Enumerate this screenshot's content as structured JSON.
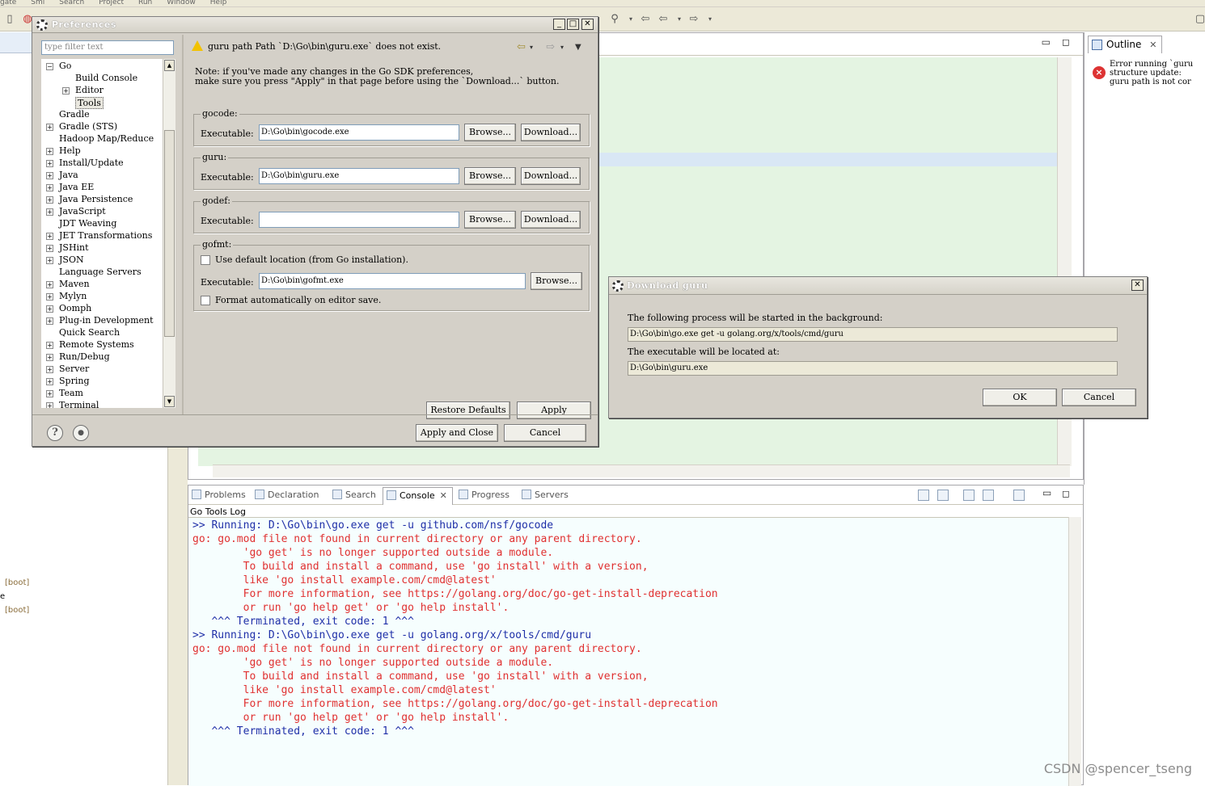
{
  "menubar": [
    "gate",
    "Sml",
    "Search",
    "Project",
    "Run",
    "Window",
    "Help"
  ],
  "left_pane": {
    "boot_labels": [
      "[boot]",
      "[boot]"
    ],
    "stray_char": "e"
  },
  "outline": {
    "tab_label": "Outline",
    "error_lines": "Error running `guru\nstructure update:\nguru path is not cor"
  },
  "console": {
    "tabs": [
      "Problems",
      "Declaration",
      "Search",
      "Console",
      "Progress",
      "Servers"
    ],
    "active_tab": "Console",
    "title": "Go Tools Log",
    "lines": [
      {
        "text": ">> Running: D:\\Go\\bin\\go.exe get -u github.com/nsf/gocode",
        "color": "blue"
      },
      {
        "text": "go: go.mod file not found in current directory or any parent directory.",
        "color": "red"
      },
      {
        "text": "        'go get' is no longer supported outside a module.",
        "color": "red"
      },
      {
        "text": "        To build and install a command, use 'go install' with a version,",
        "color": "red"
      },
      {
        "text": "        like 'go install example.com/cmd@latest'",
        "color": "red"
      },
      {
        "text": "        For more information, see https://golang.org/doc/go-get-install-deprecation",
        "color": "red"
      },
      {
        "text": "        or run 'go help get' or 'go help install'.",
        "color": "red"
      },
      {
        "text": "   ^^^ Terminated, exit code: 1 ^^^",
        "color": "blue"
      },
      {
        "text": ">> Running: D:\\Go\\bin\\go.exe get -u golang.org/x/tools/cmd/guru",
        "color": "blue"
      },
      {
        "text": "go: go.mod file not found in current directory or any parent directory.",
        "color": "red"
      },
      {
        "text": "        'go get' is no longer supported outside a module.",
        "color": "red"
      },
      {
        "text": "        To build and install a command, use 'go install' with a version,",
        "color": "red"
      },
      {
        "text": "        like 'go install example.com/cmd@latest'",
        "color": "red"
      },
      {
        "text": "        For more information, see https://golang.org/doc/go-get-install-deprecation",
        "color": "red"
      },
      {
        "text": "        or run 'go help get' or 'go help install'.",
        "color": "red"
      },
      {
        "text": "   ^^^ Terminated, exit code: 1 ^^^",
        "color": "blue"
      }
    ]
  },
  "prefs": {
    "title": "Preferences",
    "filter_placeholder": "type filter text",
    "tree": [
      {
        "label": "Go",
        "level": 0,
        "exp": "-"
      },
      {
        "label": "Build Console",
        "level": 1,
        "exp": ""
      },
      {
        "label": "Editor",
        "level": 1,
        "exp": "+"
      },
      {
        "label": "Tools",
        "level": 1,
        "exp": "",
        "selected": true
      },
      {
        "label": "Gradle",
        "level": 0,
        "exp": ""
      },
      {
        "label": "Gradle (STS)",
        "level": 0,
        "exp": "+"
      },
      {
        "label": "Hadoop Map/Reduce",
        "level": 0,
        "exp": ""
      },
      {
        "label": "Help",
        "level": 0,
        "exp": "+"
      },
      {
        "label": "Install/Update",
        "level": 0,
        "exp": "+"
      },
      {
        "label": "Java",
        "level": 0,
        "exp": "+"
      },
      {
        "label": "Java EE",
        "level": 0,
        "exp": "+"
      },
      {
        "label": "Java Persistence",
        "level": 0,
        "exp": "+"
      },
      {
        "label": "JavaScript",
        "level": 0,
        "exp": "+"
      },
      {
        "label": "JDT Weaving",
        "level": 0,
        "exp": ""
      },
      {
        "label": "JET Transformations",
        "level": 0,
        "exp": "+"
      },
      {
        "label": "JSHint",
        "level": 0,
        "exp": "+"
      },
      {
        "label": "JSON",
        "level": 0,
        "exp": "+"
      },
      {
        "label": "Language Servers",
        "level": 0,
        "exp": ""
      },
      {
        "label": "Maven",
        "level": 0,
        "exp": "+"
      },
      {
        "label": "Mylyn",
        "level": 0,
        "exp": "+"
      },
      {
        "label": "Oomph",
        "level": 0,
        "exp": "+"
      },
      {
        "label": "Plug-in Development",
        "level": 0,
        "exp": "+"
      },
      {
        "label": "Quick Search",
        "level": 0,
        "exp": ""
      },
      {
        "label": "Remote Systems",
        "level": 0,
        "exp": "+"
      },
      {
        "label": "Run/Debug",
        "level": 0,
        "exp": "+"
      },
      {
        "label": "Server",
        "level": 0,
        "exp": "+"
      },
      {
        "label": "Spring",
        "level": 0,
        "exp": "+"
      },
      {
        "label": "Team",
        "level": 0,
        "exp": "+"
      },
      {
        "label": "Terminal",
        "level": 0,
        "exp": "+"
      }
    ],
    "warning": "guru path Path `D:\\Go\\bin\\guru.exe` does not exist.",
    "note": "Note: if you've made any changes in the Go SDK preferences,\nmake sure you press \"Apply\" in that page before using the `Download...` button.",
    "gocode": {
      "legend": "gocode:",
      "label": "Executable:",
      "value": "D:\\Go\\bin\\gocode.exe",
      "browse": "Browse...",
      "download": "Download..."
    },
    "guru": {
      "legend": "guru:",
      "label": "Executable:",
      "value": "D:\\Go\\bin\\guru.exe",
      "browse": "Browse...",
      "download": "Download..."
    },
    "godef": {
      "legend": "godef:",
      "label": "Executable:",
      "value": "",
      "browse": "Browse...",
      "download": "Download..."
    },
    "gofmt": {
      "legend": "gofmt:",
      "default_loc": "Use default location (from Go installation).",
      "label": "Executable:",
      "value": "D:\\Go\\bin\\gofmt.exe",
      "browse": "Browse...",
      "format_auto": "Format automatically on editor save."
    },
    "restore_defaults": "Restore Defaults",
    "apply": "Apply",
    "apply_close": "Apply and Close",
    "cancel": "Cancel"
  },
  "download_dialog": {
    "title": "Download guru",
    "process_label": "The following process will be started in the background:",
    "process_value": "D:\\Go\\bin\\go.exe get -u golang.org/x/tools/cmd/guru",
    "location_label": "The executable will be located at:",
    "location_value": "D:\\Go\\bin\\guru.exe",
    "ok": "OK",
    "cancel": "Cancel"
  },
  "watermark": "CSDN @spencer_tseng",
  "colors": {
    "console_blue": "#1f2fa8",
    "console_red": "#e03030",
    "editor_green": "#e4f4e2",
    "dialog_bg": "#d4d0c8"
  }
}
